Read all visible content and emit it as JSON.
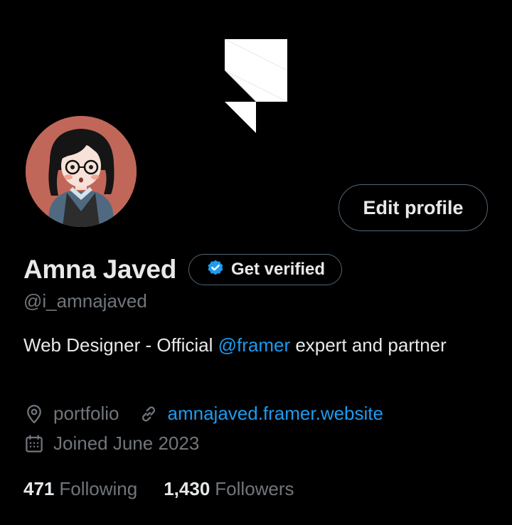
{
  "banner": {
    "logo_icon": "framer-logo-icon"
  },
  "profile": {
    "avatar_icon": "cartoon-avatar",
    "edit_button_label": "Edit profile",
    "display_name": "Amna Javed",
    "verify_badge_icon": "verified-badge-icon",
    "verify_label": "Get verified",
    "handle": "@i_amnajaved",
    "bio": {
      "prefix": "Web Designer - Official ",
      "mention": "@framer",
      "suffix": " expert and partner"
    },
    "location_icon": "location-pin-icon",
    "location": "portfolio",
    "link_icon": "link-icon",
    "website": "amnajaved.framer.website",
    "calendar_icon": "calendar-icon",
    "joined": "Joined June 2023",
    "following": {
      "count": "471",
      "label": "Following"
    },
    "followers": {
      "count": "1,430",
      "label": "Followers"
    }
  },
  "colors": {
    "background": "#000000",
    "text_primary": "#e7e9ea",
    "text_secondary": "#71767b",
    "accent": "#1d9bf0",
    "border": "#536471",
    "avatar_background": "#c0675a"
  }
}
